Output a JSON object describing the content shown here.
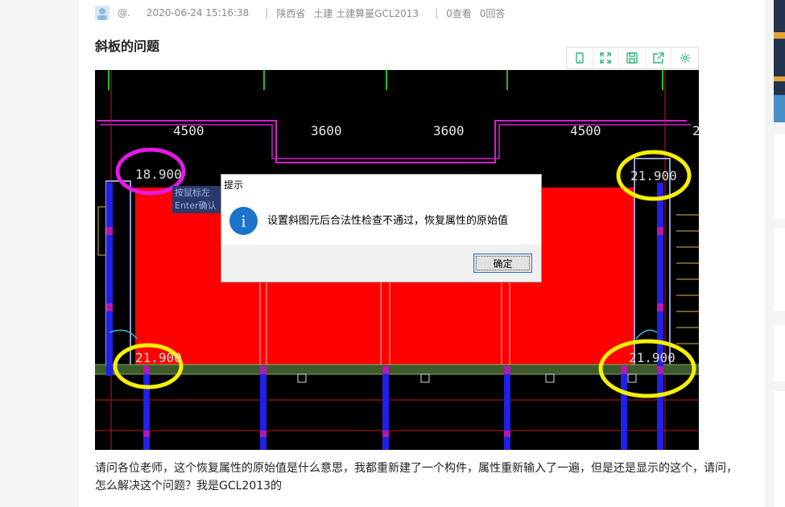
{
  "post": {
    "user": "@.",
    "datetime": "2020-06-24 15:16:38",
    "region": "陕西省",
    "tags": "土建 土建算量GCL2013",
    "views": "0查看",
    "answers": "0回答",
    "title": "斜板的问题",
    "description": "请问各位老师，这个恢复属性的原始值是什么意思，我都重新建了一个构件，属性重新输入了一遍，但是还是显示的这个，请问，怎么解决这个问题？我是GCL2013的"
  },
  "toolbar": {
    "icons": [
      "mobile-icon",
      "fullscreen-icon",
      "save-icon",
      "share-icon",
      "settings-icon"
    ],
    "accent": "#2fb37a"
  },
  "screenshot": {
    "dimensions": [
      "4500",
      "3600",
      "3600",
      "4500",
      "2"
    ],
    "elevations": [
      "18.900",
      "21.900",
      "21.900",
      "21.900"
    ],
    "hint_text": "按鼠标左 Enter确认",
    "dialog": {
      "title": "提示",
      "message": "设置斜图元后合法性检查不通过，恢复属性的原始值",
      "ok_label": "确定"
    }
  }
}
